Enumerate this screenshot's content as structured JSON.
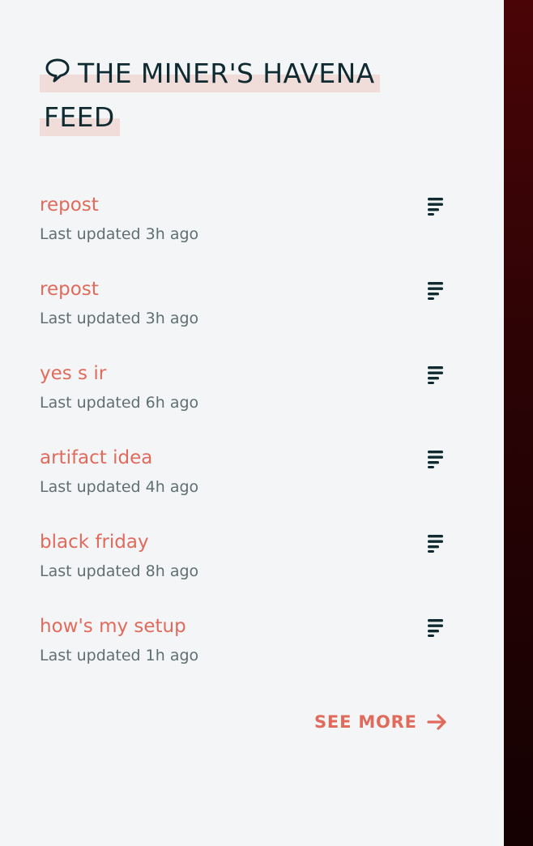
{
  "feed": {
    "title_line1": "THE MINER'S HAVENA",
    "title_line2": "FEED",
    "title_icon": "speech-bubble-icon",
    "items": [
      {
        "title": "repost",
        "meta": "Last updated 3h ago"
      },
      {
        "title": "repost",
        "meta": "Last updated 3h ago"
      },
      {
        "title": "yes s ir",
        "meta": "Last updated 6h ago"
      },
      {
        "title": "artifact idea",
        "meta": "Last updated 4h ago"
      },
      {
        "title": "black friday",
        "meta": "Last updated 8h ago"
      },
      {
        "title": "how's my setup",
        "meta": "Last updated 1h ago"
      }
    ],
    "see_more_label": "SEE MORE",
    "item_icon": "menu-lines-icon",
    "see_more_icon": "arrow-right-icon"
  },
  "colors": {
    "accent": "#e06b5c",
    "heading": "#0f2a30",
    "meta": "#5f6f72",
    "background": "#f4f5f6",
    "highlight": "#f0dcd9",
    "sidebar_dark": "#2a0305"
  }
}
